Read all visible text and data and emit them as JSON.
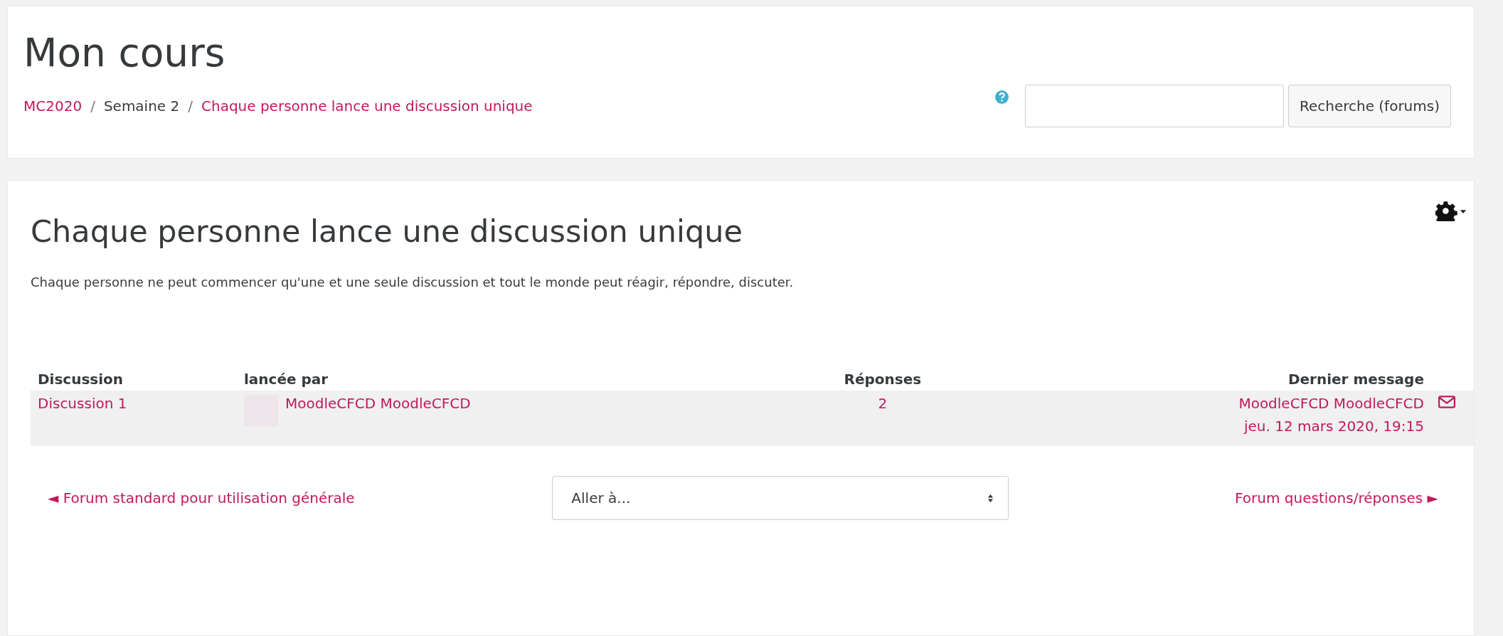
{
  "header": {
    "title": "Mon cours",
    "breadcrumb": [
      {
        "label": "MC2020",
        "link": true
      },
      {
        "label": "Semaine 2",
        "link": false
      },
      {
        "label": "Chaque personne lance une discussion unique",
        "link": true
      }
    ],
    "breadcrumb_separator": "/",
    "search": {
      "button": "Recherche (forums)"
    }
  },
  "forum": {
    "title": "Chaque personne lance une discussion unique",
    "description": "Chaque personne ne peut commencer qu'une et une seule discussion et tout le monde peut réagir, répondre, discuter.",
    "table": {
      "columns": [
        "Discussion",
        "lancée par",
        "Réponses",
        "Dernier message"
      ],
      "rows": [
        {
          "discussion": "Discussion 1",
          "started_by": "MoodleCFCD MoodleCFCD",
          "replies": "2",
          "last_author": "MoodleCFCD MoodleCFCD",
          "last_date": "jeu. 12 mars 2020, 19:15"
        }
      ]
    },
    "nav": {
      "previous": "◄ Forum standard pour utilisation générale",
      "jump_menu": {
        "value": "Aller à..."
      },
      "next": "Forum questions/réponses ►"
    }
  }
}
